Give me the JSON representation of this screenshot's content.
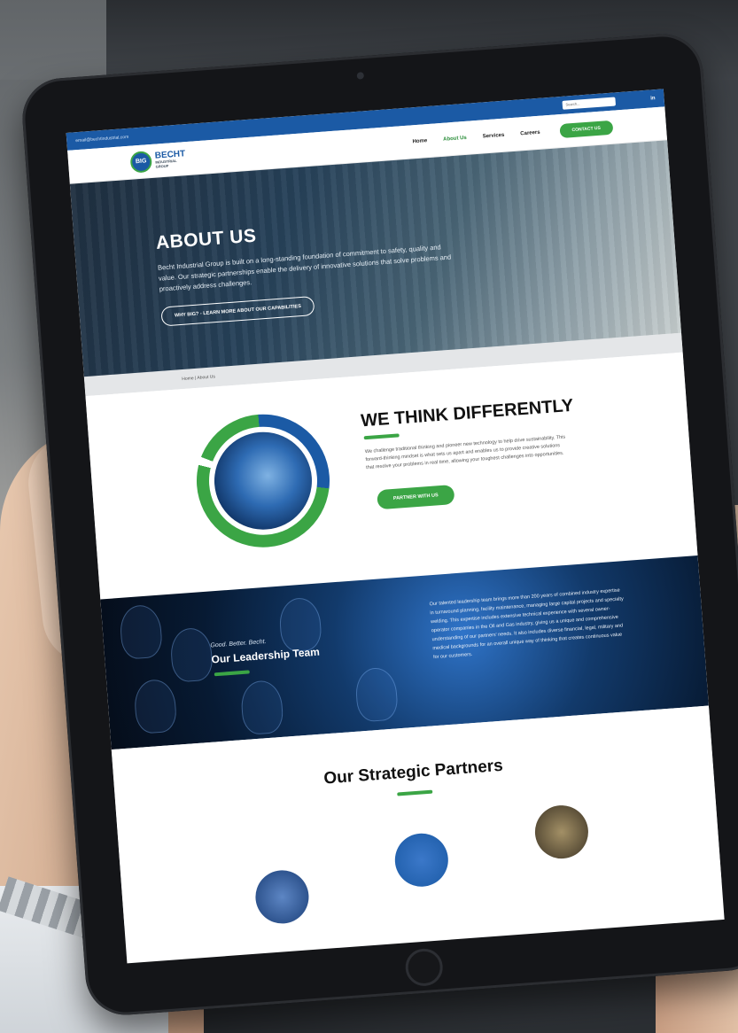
{
  "topbar": {
    "email": "email@bechtindustrial.com",
    "search_placeholder": "Search...",
    "social": "in"
  },
  "nav": {
    "logo_mark": "BIG",
    "logo_name": "BECHT",
    "logo_sub_1": "INDUSTRIAL",
    "logo_sub_2": "GROUP",
    "items": [
      "Home",
      "About Us",
      "Services",
      "Careers"
    ],
    "active": "About Us",
    "contact": "CONTACT US"
  },
  "hero": {
    "title": "ABOUT US",
    "text": "Becht Industrial Group is built on a long-standing foundation of commitment to safety, quality and value. Our strategic partnerships enable the delivery of innovative solutions that solve problems and proactively address challenges.",
    "button": "WHY BIG? - LEARN MORE ABOUT OUR CAPABILITIES"
  },
  "breadcrumb": "Home | About Us",
  "think": {
    "title": "WE THINK DIFFERENTLY",
    "text": "We challenge traditional thinking and pioneer new technology to help drive sustainability. This forward-thinking mindset is what sets us apart and enables us to provide creative solutions that resolve your problems in real time, allowing your toughest challenges into opportunities.",
    "button": "PARTNER WITH US"
  },
  "leadership": {
    "tag": "Good. Better. Becht.",
    "title": "Our Leadership Team",
    "text": "Our talented leadership team brings more than 200 years of combined industry expertise in turnaround planning, facility maintenance, managing large capital projects and specialty welding. This expertise includes extensive technical experience with several owner-operator companies in the Oil and Gas industry, giving us a unique and comprehensive understanding of our partners' needs. It also includes diverse financial, legal, military and medical backgrounds for an overall unique way of thinking that creates continuous value for our customers."
  },
  "partners": {
    "title": "Our Strategic Partners"
  },
  "colors": {
    "brand_blue": "#1b5aa5",
    "brand_green": "#3ba545"
  }
}
